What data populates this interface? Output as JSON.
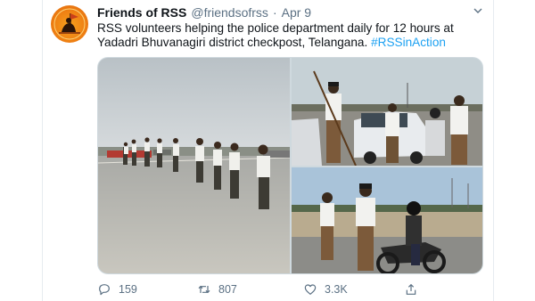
{
  "tweet": {
    "display_name": "Friends of RSS",
    "handle": "@friendsofrss",
    "separator": "·",
    "date": "Apr 9",
    "text_main": "RSS volunteers helping the police department daily for 12 hours at Yadadri Bhuvanagiri district checkpost, Telangana.",
    "hashtag": "#RSSinAction"
  },
  "actions": {
    "reply_count": "159",
    "retweet_count": "807",
    "like_count": "3.3K"
  },
  "icons": {
    "more": "chevron-down-icon",
    "reply": "reply-icon",
    "retweet": "retweet-icon",
    "like": "heart-icon",
    "share": "share-icon"
  },
  "colors": {
    "link": "#1da1f2",
    "secondary_text": "#5b7083",
    "avatar_bg": "#ee7d12"
  }
}
